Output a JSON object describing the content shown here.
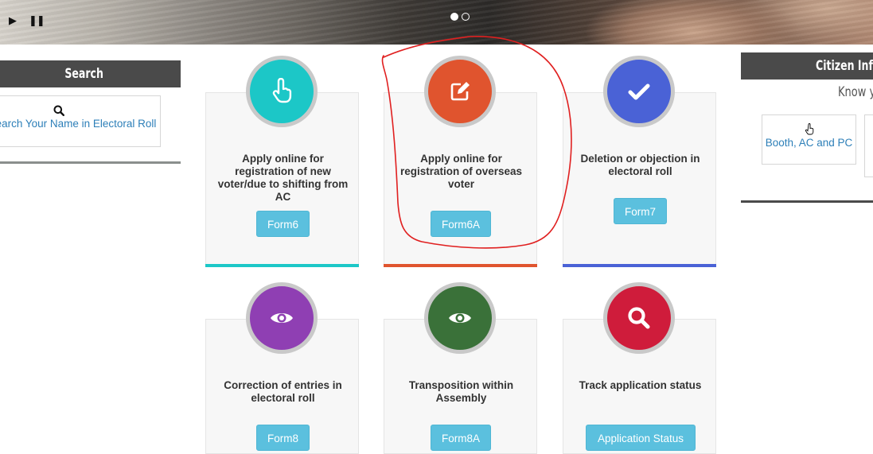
{
  "banner": {
    "play_label": "▶",
    "pause_label": "❚❚",
    "slides": [
      {
        "active": true
      },
      {
        "active": false
      }
    ]
  },
  "search_panel": {
    "title": "Search",
    "link_text": "Search Your Name in Electoral Roll",
    "icon": "search-icon"
  },
  "services": [
    {
      "title": "Apply online for registration of new voter/due to shifting from AC",
      "button": "Form6",
      "color": "#1cc7c7",
      "icon": "hand-pointer-icon"
    },
    {
      "title": "Apply online for registration of overseas voter",
      "button": "Form6A",
      "color": "#e0542e",
      "icon": "edit-icon"
    },
    {
      "title": "Deletion or objection in electoral roll",
      "button": "Form7",
      "color": "#4a62d6",
      "icon": "check-icon"
    },
    {
      "title": "Correction of entries in electoral roll",
      "button": "Form8",
      "color": "#8f3fb3",
      "icon": "eye-icon"
    },
    {
      "title": "Transposition within Assembly",
      "button": "Form8A",
      "color": "#3a7139",
      "icon": "eye-icon"
    },
    {
      "title": "Track application status",
      "button": "Application Status",
      "color": "#cf1c3b",
      "icon": "search-icon"
    }
  ],
  "citizen_panel": {
    "title": "Citizen Information",
    "subtitle": "Know your",
    "booth_link": "Booth, AC and PC"
  },
  "annotation": {
    "color": "#e02020"
  }
}
